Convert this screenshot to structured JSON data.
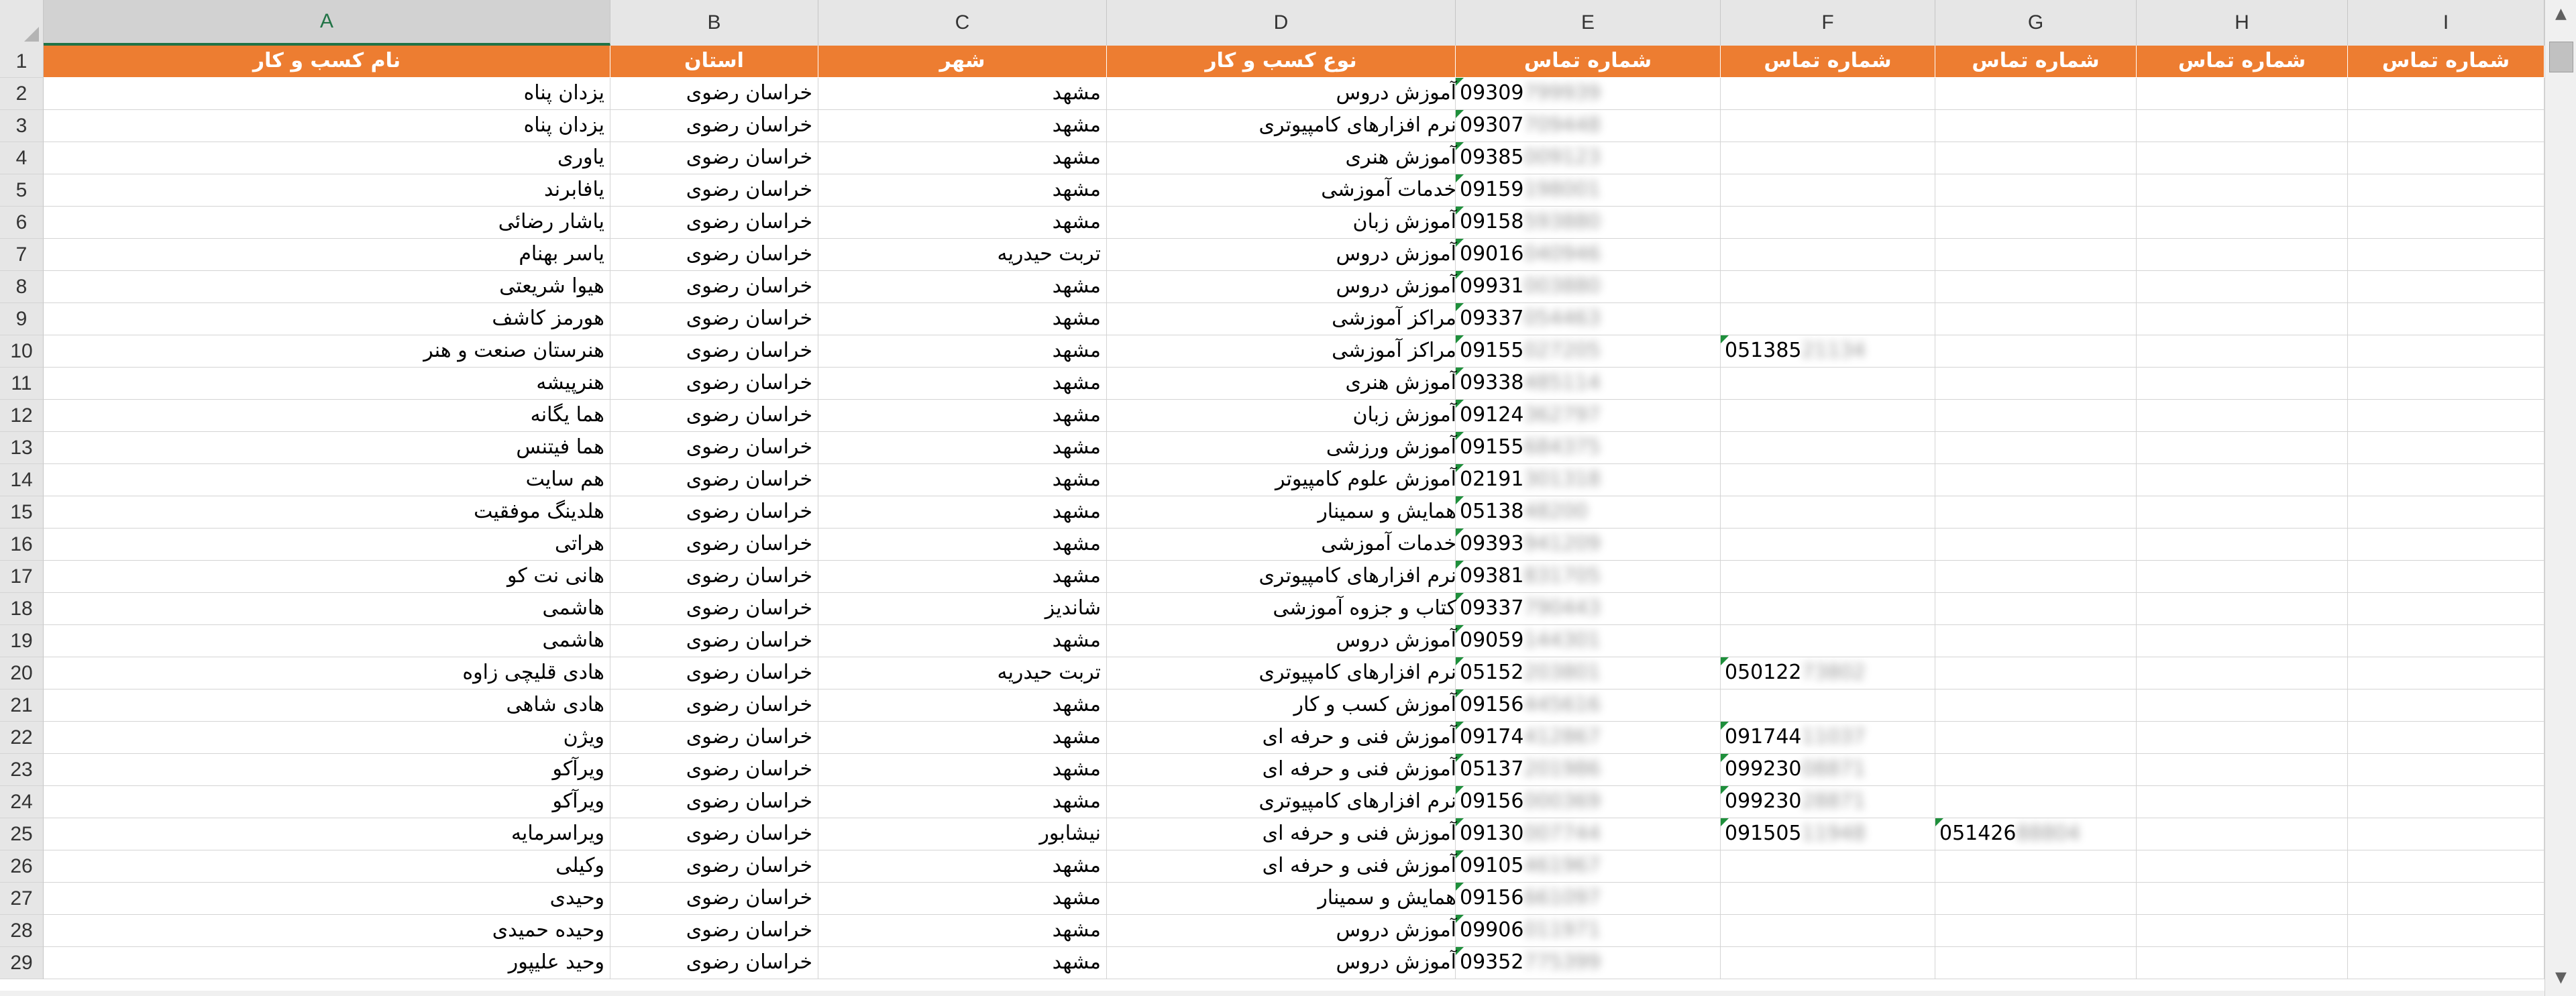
{
  "columns": [
    "A",
    "B",
    "C",
    "D",
    "E",
    "F",
    "G",
    "H",
    "I"
  ],
  "selected_column": "A",
  "header_row": {
    "number": "1",
    "cells": [
      "نام کسب و کار",
      "استان",
      "شهر",
      "نوع کسب و کار",
      "شماره تماس",
      "شماره تماس",
      "شماره تماس",
      "شماره تماس",
      "شماره تماس"
    ]
  },
  "header_colors": {
    "fill": "#ed7d31",
    "text": "#ffffff"
  },
  "rows": [
    {
      "num": "2",
      "name": "یزدان پناه",
      "province": "خراسان رضوی",
      "city": "مشهد",
      "biz": "آموزش دروس",
      "e_vis": "09309",
      "e_blur": "799939",
      "f_vis": "",
      "f_blur": "",
      "g_vis": "",
      "g_blur": ""
    },
    {
      "num": "3",
      "name": "یزدان پناه",
      "province": "خراسان رضوی",
      "city": "مشهد",
      "biz": "نرم افزارهای کامپیوتری",
      "e_vis": "09307",
      "e_blur": "709448",
      "f_vis": "",
      "f_blur": "",
      "g_vis": "",
      "g_blur": ""
    },
    {
      "num": "4",
      "name": "یاوری",
      "province": "خراسان رضوی",
      "city": "مشهد",
      "biz": "آموزش هنری",
      "e_vis": "09385",
      "e_blur": "009123",
      "f_vis": "",
      "f_blur": "",
      "g_vis": "",
      "g_blur": ""
    },
    {
      "num": "5",
      "name": "یافابرند",
      "province": "خراسان رضوی",
      "city": "مشهد",
      "biz": "خدمات آموزشی",
      "e_vis": "09159",
      "e_blur": "198001",
      "f_vis": "",
      "f_blur": "",
      "g_vis": "",
      "g_blur": ""
    },
    {
      "num": "6",
      "name": "یاشار رضائی",
      "province": "خراسان رضوی",
      "city": "مشهد",
      "biz": "آموزش زبان",
      "e_vis": "09158",
      "e_blur": "593880",
      "f_vis": "",
      "f_blur": "",
      "g_vis": "",
      "g_blur": ""
    },
    {
      "num": "7",
      "name": "یاسر بهنام",
      "province": "خراسان رضوی",
      "city": "تربت حیدریه",
      "biz": "آموزش دروس",
      "e_vis": "09016",
      "e_blur": "040946",
      "f_vis": "",
      "f_blur": "",
      "g_vis": "",
      "g_blur": ""
    },
    {
      "num": "8",
      "name": "هیوا شریعتی",
      "province": "خراسان رضوی",
      "city": "مشهد",
      "biz": "آموزش دروس",
      "e_vis": "09931",
      "e_blur": "003880",
      "f_vis": "",
      "f_blur": "",
      "g_vis": "",
      "g_blur": ""
    },
    {
      "num": "9",
      "name": "هورمز کاشف",
      "province": "خراسان رضوی",
      "city": "مشهد",
      "biz": "مراکز آموزشی",
      "e_vis": "09337",
      "e_blur": "054463",
      "f_vis": "",
      "f_blur": "",
      "g_vis": "",
      "g_blur": ""
    },
    {
      "num": "10",
      "name": "هنرستان صنعت و هنر",
      "province": "خراسان رضوی",
      "city": "مشهد",
      "biz": "مراکز آموزشی",
      "e_vis": "09155",
      "e_blur": "027205",
      "f_vis": "051385",
      "f_blur": "21134",
      "g_vis": "",
      "g_blur": ""
    },
    {
      "num": "11",
      "name": "هنرپیشه",
      "province": "خراسان رضوی",
      "city": "مشهد",
      "biz": "آموزش هنری",
      "e_vis": "09338",
      "e_blur": "485114",
      "f_vis": "",
      "f_blur": "",
      "g_vis": "",
      "g_blur": ""
    },
    {
      "num": "12",
      "name": "هما یگانه",
      "province": "خراسان رضوی",
      "city": "مشهد",
      "biz": "آموزش زبان",
      "e_vis": "09124",
      "e_blur": "362797",
      "f_vis": "",
      "f_blur": "",
      "g_vis": "",
      "g_blur": ""
    },
    {
      "num": "13",
      "name": "هما فیتنس",
      "province": "خراسان رضوی",
      "city": "مشهد",
      "biz": "آموزش ورزشی",
      "e_vis": "09155",
      "e_blur": "684375",
      "f_vis": "",
      "f_blur": "",
      "g_vis": "",
      "g_blur": ""
    },
    {
      "num": "14",
      "name": "هم سایت",
      "province": "خراسان رضوی",
      "city": "مشهد",
      "biz": "آموزش علوم کامپیوتر",
      "e_vis": "02191",
      "e_blur": "301318",
      "f_vis": "",
      "f_blur": "",
      "g_vis": "",
      "g_blur": ""
    },
    {
      "num": "15",
      "name": "هلدینگ موفقیت",
      "province": "خراسان رضوی",
      "city": "مشهد",
      "biz": "همایش و سمینار",
      "e_vis": "05138",
      "e_blur": "48200",
      "f_vis": "",
      "f_blur": "",
      "g_vis": "",
      "g_blur": ""
    },
    {
      "num": "16",
      "name": "هراتی",
      "province": "خراسان رضوی",
      "city": "مشهد",
      "biz": "خدمات آموزشی",
      "e_vis": "09393",
      "e_blur": "941209",
      "f_vis": "",
      "f_blur": "",
      "g_vis": "",
      "g_blur": ""
    },
    {
      "num": "17",
      "name": "هانی نت کو",
      "province": "خراسان رضوی",
      "city": "مشهد",
      "biz": "نرم افزارهای کامپیوتری",
      "e_vis": "09381",
      "e_blur": "831705",
      "f_vis": "",
      "f_blur": "",
      "g_vis": "",
      "g_blur": ""
    },
    {
      "num": "18",
      "name": "هاشمی",
      "province": "خراسان رضوی",
      "city": "شاندیز",
      "biz": "کتاب و جزوه آموزشی",
      "e_vis": "09337",
      "e_blur": "790443",
      "f_vis": "",
      "f_blur": "",
      "g_vis": "",
      "g_blur": ""
    },
    {
      "num": "19",
      "name": "هاشمی",
      "province": "خراسان رضوی",
      "city": "مشهد",
      "biz": "آموزش دروس",
      "e_vis": "09059",
      "e_blur": "144301",
      "f_vis": "",
      "f_blur": "",
      "g_vis": "",
      "g_blur": ""
    },
    {
      "num": "20",
      "name": "هادی قلیچی زاوه",
      "province": "خراسان رضوی",
      "city": "تربت حیدریه",
      "biz": "نرم افزارهای کامپیوتری",
      "e_vis": "05152",
      "e_blur": "203801",
      "f_vis": "050122",
      "f_blur": "73802",
      "g_vis": "",
      "g_blur": ""
    },
    {
      "num": "21",
      "name": "هادی شاهی",
      "province": "خراسان رضوی",
      "city": "مشهد",
      "biz": "آموزش کسب و کار",
      "e_vis": "09156",
      "e_blur": "445616",
      "f_vis": "",
      "f_blur": "",
      "g_vis": "",
      "g_blur": ""
    },
    {
      "num": "22",
      "name": "ویژن",
      "province": "خراسان رضوی",
      "city": "مشهد",
      "biz": "آموزش فنی و حرفه ای",
      "e_vis": "09174",
      "e_blur": "412867",
      "f_vis": "091744",
      "f_blur": "11037",
      "g_vis": "",
      "g_blur": ""
    },
    {
      "num": "23",
      "name": "ویرآکو",
      "province": "خراسان رضوی",
      "city": "مشهد",
      "biz": "آموزش فنی و حرفه ای",
      "e_vis": "05137",
      "e_blur": "201986",
      "f_vis": "099230",
      "f_blur": "08871",
      "g_vis": "",
      "g_blur": ""
    },
    {
      "num": "24",
      "name": "ویرآکو",
      "province": "خراسان رضوی",
      "city": "مشهد",
      "biz": "نرم افزارهای کامپیوتری",
      "e_vis": "09156",
      "e_blur": "000369",
      "f_vis": "099230",
      "f_blur": "28871",
      "g_vis": "",
      "g_blur": ""
    },
    {
      "num": "25",
      "name": "ویراسرمایه",
      "province": "خراسان رضوی",
      "city": "نیشابور",
      "biz": "آموزش فنی و حرفه ای",
      "e_vis": "09130",
      "e_blur": "007744",
      "f_vis": "091505",
      "f_blur": "11948",
      "g_vis": "051426",
      "g_blur": "88804"
    },
    {
      "num": "26",
      "name": "وکیلی",
      "province": "خراسان رضوی",
      "city": "مشهد",
      "biz": "آموزش فنی و حرفه ای",
      "e_vis": "09105",
      "e_blur": "461967",
      "f_vis": "",
      "f_blur": "",
      "g_vis": "",
      "g_blur": ""
    },
    {
      "num": "27",
      "name": "وحیدی",
      "province": "خراسان رضوی",
      "city": "مشهد",
      "biz": "همایش و سمینار",
      "e_vis": "09156",
      "e_blur": "661097",
      "f_vis": "",
      "f_blur": "",
      "g_vis": "",
      "g_blur": ""
    },
    {
      "num": "28",
      "name": "وحیده حمیدی",
      "province": "خراسان رضوی",
      "city": "مشهد",
      "biz": "آموزش دروس",
      "e_vis": "09906",
      "e_blur": "011971",
      "f_vis": "",
      "f_blur": "",
      "g_vis": "",
      "g_blur": ""
    },
    {
      "num": "29",
      "name": "وحید علیپور",
      "province": "خراسان رضوی",
      "city": "مشهد",
      "biz": "آموزش دروس",
      "e_vis": "09352",
      "e_blur": "775399",
      "f_vis": "",
      "f_blur": "",
      "g_vis": "",
      "g_blur": ""
    }
  ],
  "scroll_icons": {
    "up": "chevron-up-icon",
    "down": "chevron-down-icon"
  }
}
